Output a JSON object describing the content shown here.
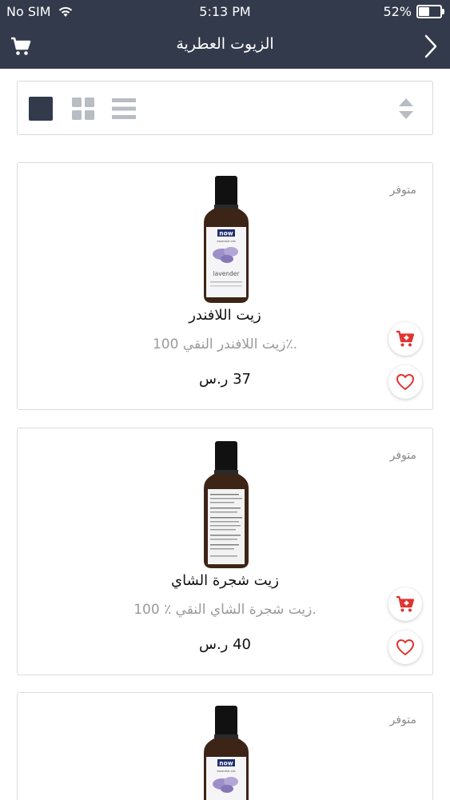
{
  "status_bar": {
    "carrier": "No SIM",
    "time": "5:13 PM",
    "battery": "52%",
    "battery_level": 0.52
  },
  "nav": {
    "title": "الزيوت العطرية"
  },
  "colors": {
    "header_bg": "#323a4b",
    "accent_red": "#e0322f",
    "active_view": "#323a4b",
    "inactive_view": "#b8bcc3"
  },
  "icons": {
    "cart": "cart-icon",
    "back": "chevron-right-icon",
    "grid_large": "square-view-icon",
    "grid_small": "grid-view-icon",
    "list": "list-view-icon",
    "sort": "sort-icon",
    "add_to_cart": "add-to-cart-icon",
    "favorite": "heart-icon"
  },
  "products": [
    {
      "availability": "متوفر",
      "name": "زيت اللافندر",
      "description": "زيت اللافندر النقي 100٪.",
      "price": "37 ر.س",
      "label_brand": "now",
      "label_sub": "essential oils",
      "label_text": "lavender"
    },
    {
      "availability": "متوفر",
      "name": "زيت شجرة الشاي",
      "description": "100 ٪ زيت شجرة الشاي النقي.",
      "price": "40 ر.س"
    },
    {
      "availability": "متوفر",
      "label_brand": "now",
      "label_sub": "essential oils"
    }
  ]
}
